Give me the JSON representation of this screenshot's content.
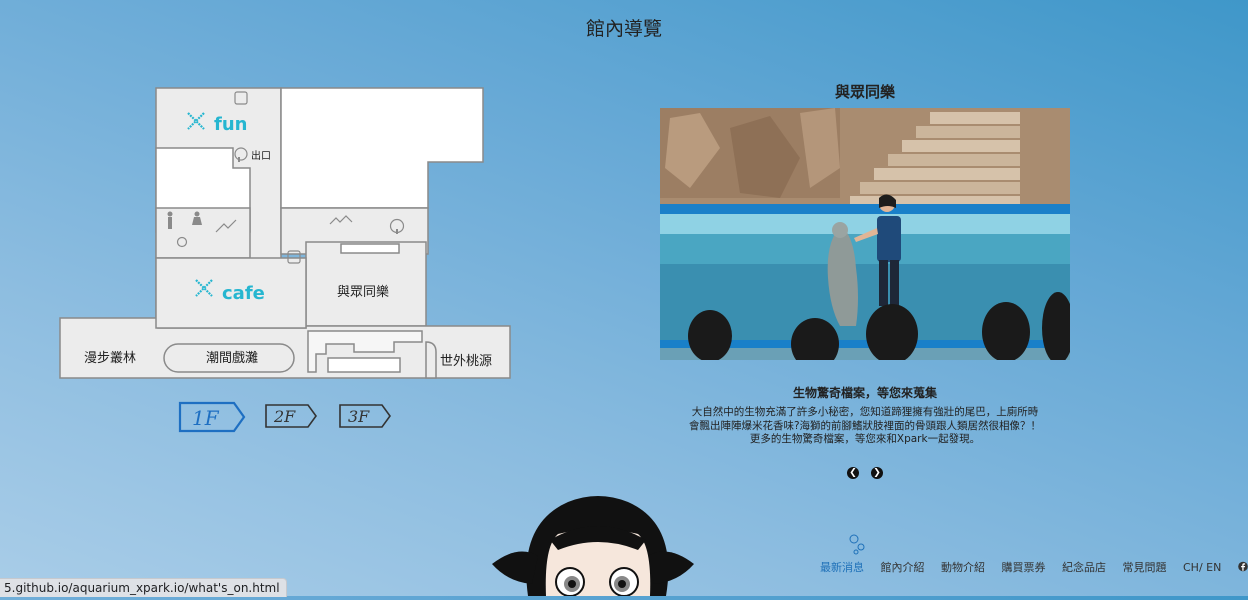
{
  "header": {
    "title": "館內導覽"
  },
  "map": {
    "labels": {
      "xfun": "fun",
      "xcafe": "cafe",
      "exit": "出口",
      "zone_together": "與眾同樂",
      "zone_forest": "漫步叢林",
      "zone_tidal": "潮間戲灘",
      "zone_paradise": "世外桃源"
    },
    "floors": [
      {
        "label": "1F",
        "active": true
      },
      {
        "label": "2F",
        "active": false
      },
      {
        "label": "3F",
        "active": false
      }
    ],
    "colors": {
      "floor": "#ececec",
      "wall": "#8a8a8a",
      "accent": "#26b6d0"
    }
  },
  "exhibit": {
    "title": "與眾同樂",
    "subtitle": "生物驚奇檔案，等您來蒐集",
    "body_lines": [
      "大自然中的生物充滿了許多小秘密，您知道蹄狸擁有強壯的尾巴，上廁所時",
      "會飄出陣陣爆米花香味?海獅的前腳鰭狀肢裡面的骨頭跟人類居然很相像？！",
      "更多的生物驚奇檔案，等您來和Xpark一起發現。"
    ],
    "prev_icon": "chevron-left-icon",
    "next_icon": "chevron-right-icon"
  },
  "nav": {
    "items": [
      {
        "label": "最新消息",
        "active": true
      },
      {
        "label": "館內介紹",
        "active": false
      },
      {
        "label": "動物介紹",
        "active": false
      },
      {
        "label": "購買票券",
        "active": false
      },
      {
        "label": "紀念品店",
        "active": false
      },
      {
        "label": "常見問題",
        "active": false
      },
      {
        "label": "CH/ EN",
        "active": false
      }
    ],
    "active_color": "#1e70b8"
  },
  "status": {
    "url": "5.github.io/aquarium_xpark.io/what's_on.html"
  }
}
